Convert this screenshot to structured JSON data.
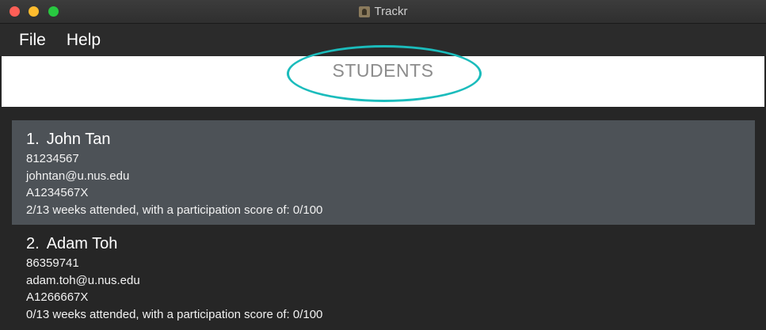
{
  "window": {
    "title": "Trackr"
  },
  "menu": {
    "items": [
      "File",
      "Help"
    ]
  },
  "header": {
    "title": "STUDENTS"
  },
  "students": [
    {
      "index": "1.",
      "name": "John Tan",
      "phone": "81234567",
      "email": "johntan@u.nus.edu",
      "student_id": "A1234567X",
      "attendance": "2/13 weeks attended, with a participation score of: 0/100"
    },
    {
      "index": "2.",
      "name": "Adam Toh",
      "phone": "86359741",
      "email": "adam.toh@u.nus.edu",
      "student_id": "A1266667X",
      "attendance": "0/13 weeks attended, with a participation score of: 0/100"
    }
  ],
  "colors": {
    "annotation": "#1bbcbc",
    "selected_card": "#4d5257",
    "background": "#262626"
  }
}
